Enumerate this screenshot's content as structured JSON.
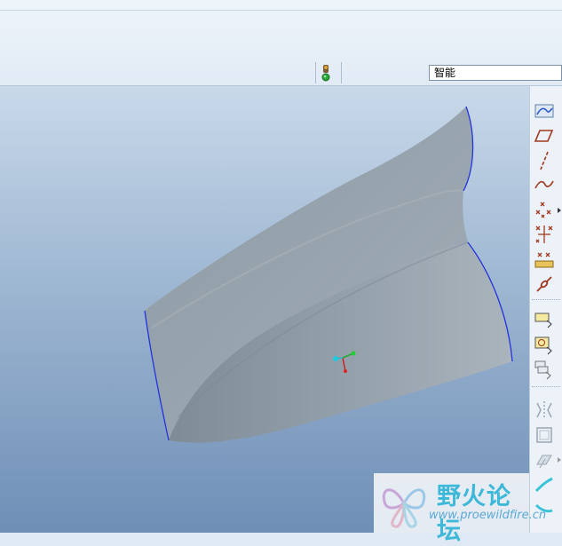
{
  "toolbar": {
    "status_indicator": "traffic-light-icon",
    "filter": {
      "value": "智能"
    }
  },
  "viewport": {
    "background_top": "#c9d9ea",
    "background_bottom": "#6f8fb7",
    "model": "surface-part",
    "edge_color": "#2233dd"
  },
  "side_toolbar": {
    "tools": [
      "sketch-datum-icon",
      "datum-plane-icon",
      "datum-axis-icon",
      "datum-curve-icon",
      "datum-point-icon",
      "offset-point-icon",
      "field-point-icon",
      "coordinate-system-icon",
      "note-icon",
      "analysis-note-icon",
      "layer-note-icon",
      "mirror-icon",
      "frame-icon",
      "copy-surface-icon",
      "extend-icon",
      "trim-icon"
    ]
  },
  "watermark": {
    "title": "野火论坛",
    "url": "www.proewildfire.cn"
  }
}
